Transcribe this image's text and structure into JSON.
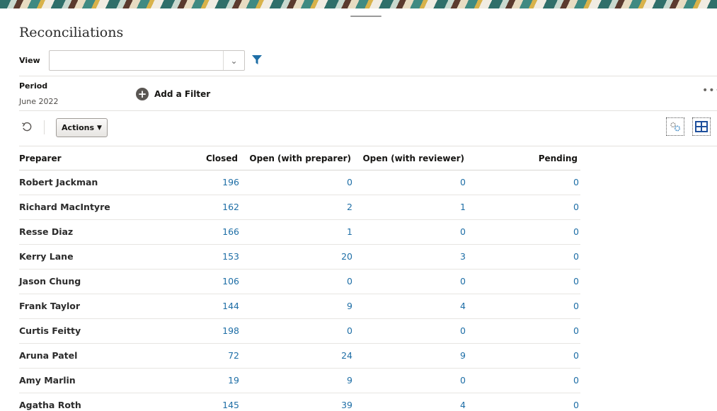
{
  "page_title": "Reconciliations",
  "view": {
    "label": "View",
    "value": ""
  },
  "period": {
    "label": "Period",
    "value": "June 2022"
  },
  "add_filter_label": "Add a Filter",
  "more_label": "•••",
  "actions_label": "Actions",
  "columns": [
    "Preparer",
    "Closed",
    "Open (with preparer)",
    "Open (with reviewer)",
    "Pending"
  ],
  "rows": [
    {
      "preparer": "Robert Jackman",
      "closed": "196",
      "open_preparer": "0",
      "open_reviewer": "0",
      "pending": "0"
    },
    {
      "preparer": "Richard MacIntyre",
      "closed": "162",
      "open_preparer": "2",
      "open_reviewer": "1",
      "pending": "0"
    },
    {
      "preparer": "Resse Diaz",
      "closed": "166",
      "open_preparer": "1",
      "open_reviewer": "0",
      "pending": "0"
    },
    {
      "preparer": "Kerry Lane",
      "closed": "153",
      "open_preparer": "20",
      "open_reviewer": "3",
      "pending": "0"
    },
    {
      "preparer": "Jason Chung",
      "closed": "106",
      "open_preparer": "0",
      "open_reviewer": "0",
      "pending": "0"
    },
    {
      "preparer": "Frank Taylor",
      "closed": "144",
      "open_preparer": "9",
      "open_reviewer": "4",
      "pending": "0"
    },
    {
      "preparer": "Curtis Feitty",
      "closed": "198",
      "open_preparer": "0",
      "open_reviewer": "0",
      "pending": "0"
    },
    {
      "preparer": "Aruna Patel",
      "closed": "72",
      "open_preparer": "24",
      "open_reviewer": "9",
      "pending": "0"
    },
    {
      "preparer": "Amy Marlin",
      "closed": "19",
      "open_preparer": "9",
      "open_reviewer": "0",
      "pending": "0"
    },
    {
      "preparer": "Agatha Roth",
      "closed": "145",
      "open_preparer": "39",
      "open_reviewer": "4",
      "pending": "0"
    }
  ],
  "colors": {
    "link": "#1e6ea6",
    "filter_icon": "#1e6ea6",
    "layout_icon": "#1e4f9c"
  },
  "icons": [
    "chevron-down-icon",
    "filter-icon",
    "add-circle-icon",
    "more-icon",
    "refresh-icon",
    "caret-down-icon",
    "settings-icon",
    "layout-icon"
  ]
}
